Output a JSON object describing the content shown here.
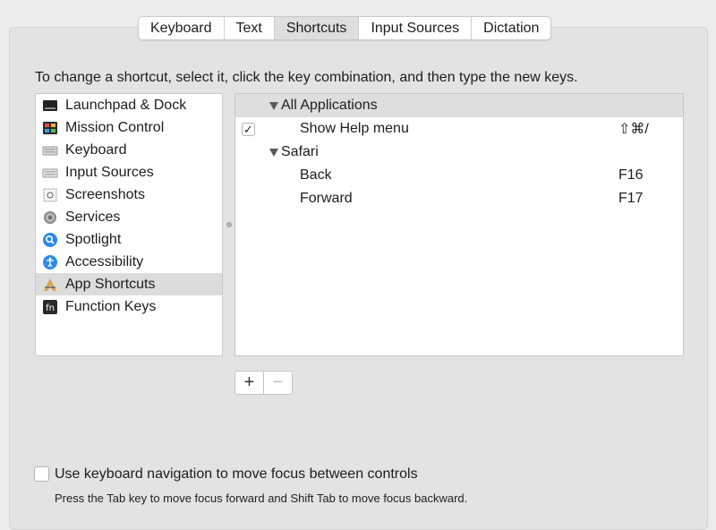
{
  "tabs": [
    {
      "label": "Keyboard"
    },
    {
      "label": "Text"
    },
    {
      "label": "Shortcuts"
    },
    {
      "label": "Input Sources"
    },
    {
      "label": "Dictation"
    }
  ],
  "selected_tab": "Shortcuts",
  "instructions": "To change a shortcut, select it, click the key combination, and then type the new keys.",
  "categories": [
    {
      "label": "Launchpad & Dock",
      "icon": "launchpad-dock-icon"
    },
    {
      "label": "Mission Control",
      "icon": "mission-control-icon"
    },
    {
      "label": "Keyboard",
      "icon": "keyboard-icon"
    },
    {
      "label": "Input Sources",
      "icon": "input-sources-icon"
    },
    {
      "label": "Screenshots",
      "icon": "screenshots-icon"
    },
    {
      "label": "Services",
      "icon": "services-gear-icon"
    },
    {
      "label": "Spotlight",
      "icon": "spotlight-icon"
    },
    {
      "label": "Accessibility",
      "icon": "accessibility-icon"
    },
    {
      "label": "App Shortcuts",
      "icon": "app-shortcuts-icon",
      "selected": true
    },
    {
      "label": "Function Keys",
      "icon": "function-keys-icon"
    }
  ],
  "shortcuts": {
    "group1": {
      "label": "All Applications"
    },
    "item1": {
      "name": "Show Help menu",
      "keys": "⇧⌘/",
      "checked": true
    },
    "group2": {
      "label": "Safari"
    },
    "item2": {
      "name": "Back",
      "keys": "F16"
    },
    "item3": {
      "name": "Forward",
      "keys": "F17"
    }
  },
  "buttons": {
    "add": "+",
    "remove": "−"
  },
  "keyboard_nav": {
    "label": "Use keyboard navigation to move focus between controls",
    "checked": false,
    "help": "Press the Tab key to move focus forward and Shift Tab to move focus backward."
  },
  "colors": {
    "selection": "#dcdcdc",
    "background": "#ececec"
  }
}
